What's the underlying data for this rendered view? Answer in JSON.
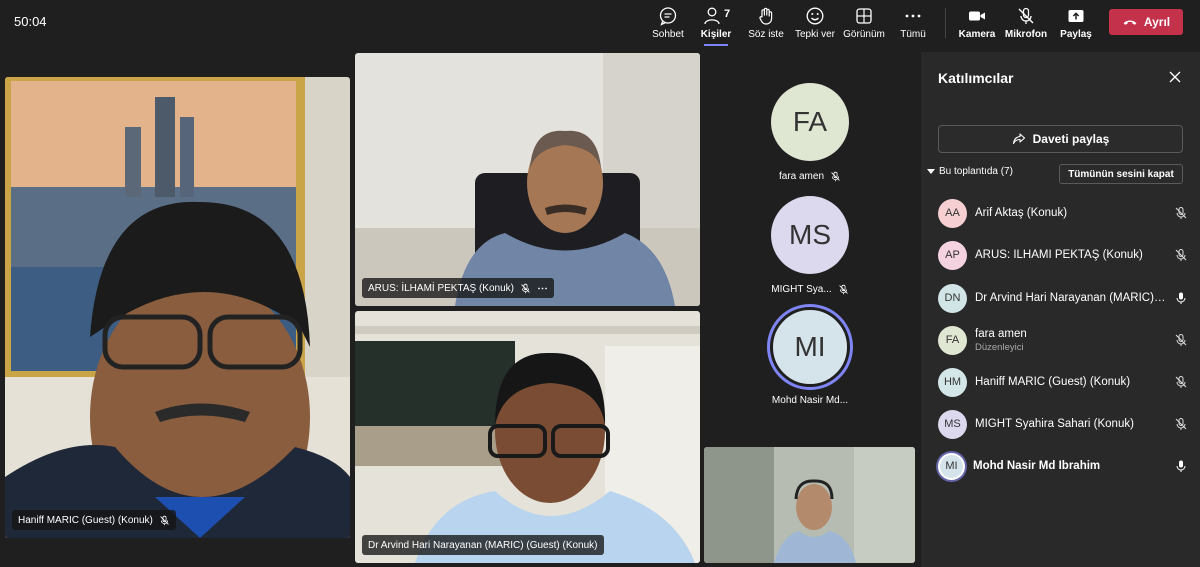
{
  "timer": "50:04",
  "toolbar": {
    "chat": "Sohbet",
    "people": "Kişiler",
    "people_count": "7",
    "raise_hand": "Söz iste",
    "react": "Tepki ver",
    "view": "Görünüm",
    "more": "Tümü",
    "camera": "Kamera",
    "mic": "Mikrofon",
    "share": "Paylaş",
    "leave": "Ayrıl"
  },
  "stage": {
    "tile_haniff": "Haniff MARIC (Guest) (Konuk)",
    "tile_arus": "ARUS: İLHAMİ PEKTAŞ (Konuk)",
    "tile_arvind": "Dr Arvind Hari Narayanan (MARIC) (Guest) (Konuk)",
    "avatar_fa": {
      "initials": "FA",
      "name": "fara amen"
    },
    "avatar_ms": {
      "initials": "MS",
      "name": "MIGHT Sya..."
    },
    "avatar_mi": {
      "initials": "MI",
      "name": "Mohd Nasir Md..."
    }
  },
  "panel": {
    "title": "Katılımcılar",
    "invite": "Daveti paylaş",
    "section": "Bu toplantıda (7)",
    "mute_all": "Tümünün sesini kapat",
    "participants": [
      {
        "initials": "AA",
        "name": "Arif Aktaş (Konuk)",
        "sub": "",
        "mic": "muted",
        "color": "#f6cfd3"
      },
      {
        "initials": "AP",
        "name": "ARUS: İLHAMİ PEKTAŞ (Konuk)",
        "sub": "",
        "mic": "muted",
        "color": "#f4d2e0"
      },
      {
        "initials": "DN",
        "name": "Dr Arvind Hari Narayanan (MARIC) (Guest) (Konuk)",
        "sub": "",
        "mic": "on",
        "color": "#d2e5e6"
      },
      {
        "initials": "FA",
        "name": "fara amen",
        "sub": "Düzenleyici",
        "mic": "muted",
        "color": "#dfe6d2"
      },
      {
        "initials": "HM",
        "name": "Haniff MARIC (Guest) (Konuk)",
        "sub": "",
        "mic": "muted",
        "color": "#d3e6e8"
      },
      {
        "initials": "MS",
        "name": "MIGHT Syahira Sahari (Konuk)",
        "sub": "",
        "mic": "muted",
        "color": "#dcd9ee"
      },
      {
        "initials": "MI",
        "name": "Mohd Nasir Md Ibrahim",
        "sub": "",
        "mic": "on",
        "color": "#d5e3ea"
      }
    ]
  },
  "colors": {
    "accent": "#7f85f5",
    "leave": "#c4314b",
    "panel_bg": "#292929",
    "stage_bg": "#1f1f1f"
  }
}
